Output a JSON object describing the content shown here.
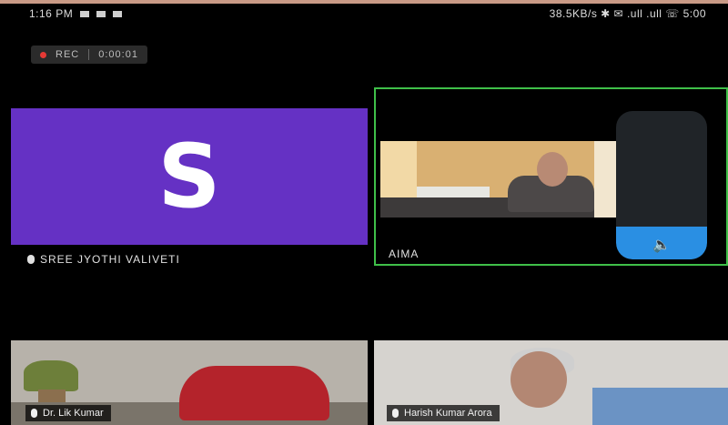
{
  "status_bar": {
    "time": "1:16 PM",
    "right_text": "38.5KB/s ✱ ✉ .ull .ull ☏ 5:00"
  },
  "recording": {
    "rec_label": "REC",
    "timer": "0:00:01"
  },
  "participants": [
    {
      "id": "s",
      "avatar_letter": "S",
      "name": "SREE JYOTHI VALIVETI",
      "avatar_color": "#6531c4"
    },
    {
      "id": "aima",
      "name": "AIMA",
      "active_speaker": true,
      "highlight_color": "#3fbf49"
    },
    {
      "id": "bl",
      "name": "Dr. Lik Kumar"
    },
    {
      "id": "br",
      "name": "Harish Kumar Arora"
    }
  ],
  "volume": {
    "level": 0.22,
    "icon": "speaker-icon",
    "accent": "#2a8fe3"
  }
}
